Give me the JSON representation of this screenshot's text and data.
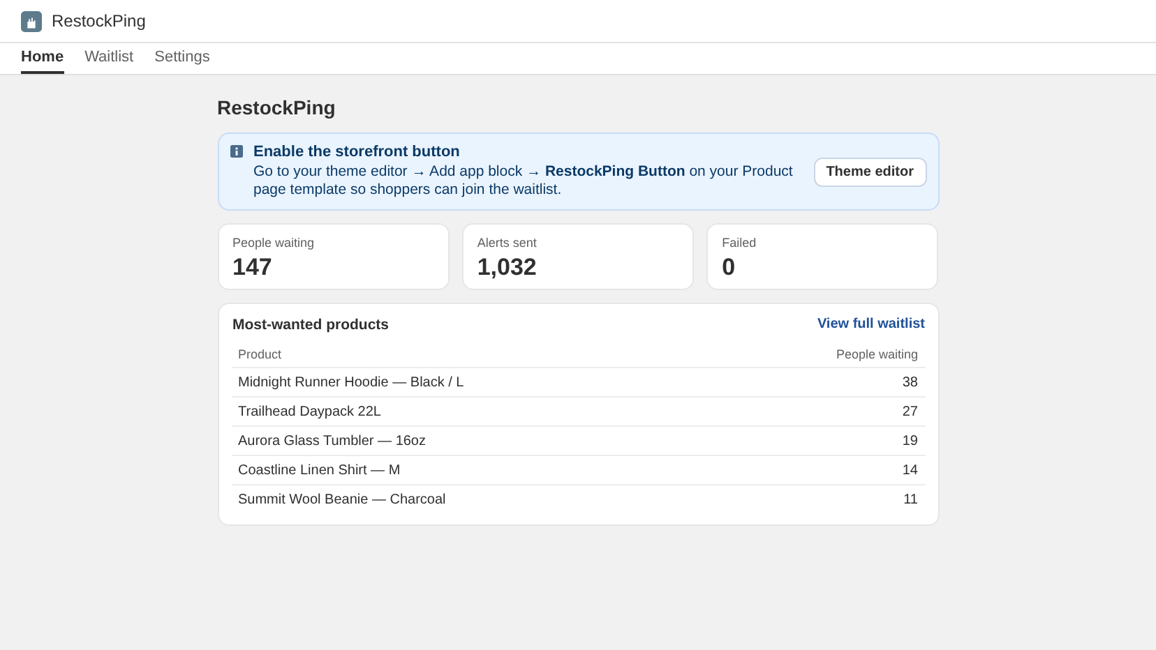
{
  "app": {
    "name": "RestockPing"
  },
  "tabs": [
    {
      "label": "Home",
      "selected": true
    },
    {
      "label": "Waitlist",
      "selected": false
    },
    {
      "label": "Settings",
      "selected": false
    }
  ],
  "page_title": "RestockPing",
  "banner": {
    "title": "Enable the storefront button",
    "text": "Go to your theme editor → Add app block → **RestockPing Button** on your Product page template so shoppers can join the waitlist.",
    "button": "Theme editor"
  },
  "stats": [
    {
      "label": "People waiting",
      "value": "147"
    },
    {
      "label": "Alerts sent",
      "value": "1,032"
    },
    {
      "label": "Failed",
      "value": "0"
    }
  ],
  "products": {
    "title": "Most-wanted products",
    "link": "View full waitlist",
    "columns": [
      "Product",
      "People waiting"
    ],
    "rows": [
      {
        "product": "Midnight Runner Hoodie — Black / L",
        "waiting": "38"
      },
      {
        "product": "Trailhead Daypack 22L",
        "waiting": "27"
      },
      {
        "product": "Aurora Glass Tumbler — 16oz",
        "waiting": "19"
      },
      {
        "product": "Coastline Linen Shirt — M",
        "waiting": "14"
      },
      {
        "product": "Summit Wool Beanie — Charcoal",
        "waiting": "11"
      }
    ]
  }
}
